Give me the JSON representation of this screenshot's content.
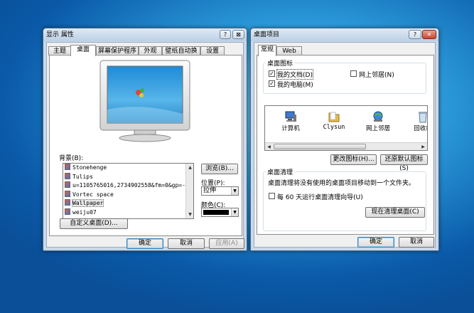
{
  "display_props": {
    "title": "显示 属性",
    "help_btn": "?",
    "close_btn": "⊠",
    "tabs": [
      "主题",
      "桌面",
      "屏幕保护程序",
      "外观",
      "壁纸自动换",
      "设置"
    ],
    "background_label": "背景(B):",
    "backgrounds": [
      "Stonehenge",
      "Tulips",
      "u=1105765016,2734902558&fm=0&gp=-6",
      "Vortec space",
      "Wallpaper",
      "weiju07"
    ],
    "browse_btn": "浏览(B)...",
    "position_label": "位置(P):",
    "position_value": "拉伸",
    "color_label": "颜色(C):",
    "color_value": "#000000",
    "customize_btn": "自定义桌面(D)...",
    "ok_btn": "确定",
    "cancel_btn": "取消",
    "apply_btn": "应用(A)"
  },
  "desktop_items": {
    "title": "桌面项目",
    "help_btn": "?",
    "close_btn": "✕",
    "tabs": [
      "常规",
      "Web"
    ],
    "icons_group": "桌面图标",
    "cb_mydocs": "我的文档(D)",
    "cb_network": "网上邻居(N)",
    "cb_mycomp": "我的电脑(M)",
    "icons": [
      "计算机",
      "Clysun",
      "网上邻居",
      "回收站"
    ],
    "change_icon_btn": "更改图标(H)...",
    "restore_btn": "还原默认图标(S)",
    "cleanup_group": "桌面清理",
    "cleanup_desc": "桌面清理将没有使用的桌面项目移动到一个文件夹。",
    "cb_cleanup": "每 60 天运行桌面清理向导(U)",
    "clean_now_btn": "现在清理桌面(C)",
    "ok_btn": "确定",
    "cancel_btn": "取消"
  }
}
